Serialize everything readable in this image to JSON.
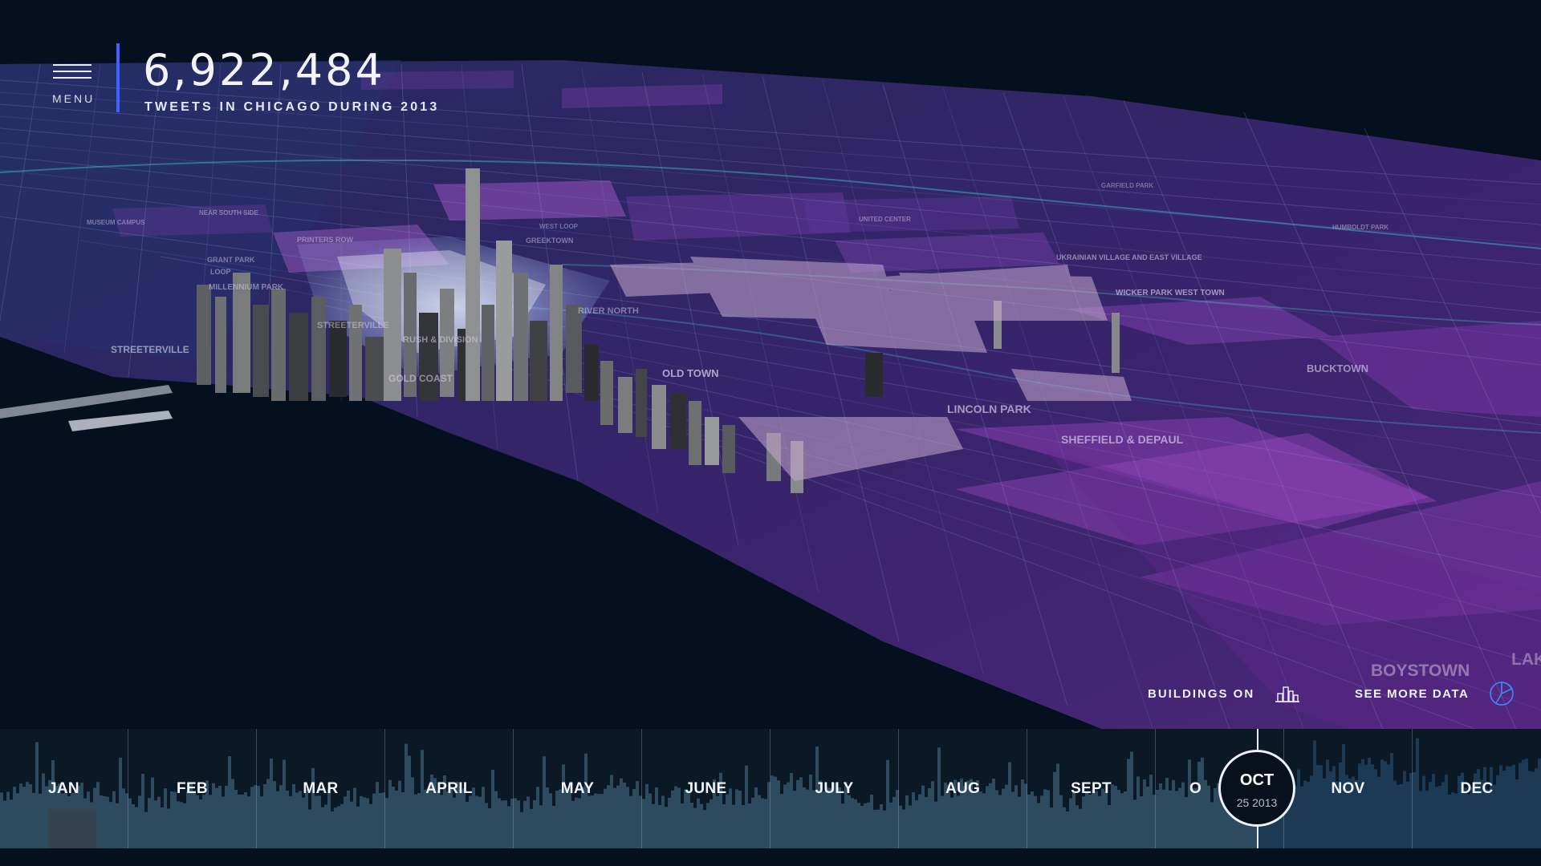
{
  "header": {
    "menu_label": "MENU",
    "tweet_count": "6,922,484",
    "caption": "TWEETS IN CHICAGO DURING 2013"
  },
  "map": {
    "labels": [
      {
        "text": "STREETERVILLE",
        "size": "big"
      },
      {
        "text": "LINCOLN PARK",
        "size": "big"
      },
      {
        "text": "SHEFFIELD & DEPAUL",
        "size": "big"
      },
      {
        "text": "BUCKTOWN",
        "size": "big"
      },
      {
        "text": "WICKER PARK WEST TOWN",
        "size": "normal"
      },
      {
        "text": "UKRAINIAN VILLAGE AND EAST VILLAGE",
        "size": "normal"
      },
      {
        "text": "OLD TOWN",
        "size": "big"
      },
      {
        "text": "GOLD COAST",
        "size": "normal"
      },
      {
        "text": "RUSH & DIVISION",
        "size": "normal"
      },
      {
        "text": "RIVER NORTH",
        "size": "normal"
      },
      {
        "text": "STREETERVILLE",
        "size": "normal"
      },
      {
        "text": "MILLENNIUM PARK",
        "size": "normal"
      },
      {
        "text": "LOOP",
        "size": "normal"
      },
      {
        "text": "GRANT PARK",
        "size": "normal"
      },
      {
        "text": "PRINTERS ROW",
        "size": "normal"
      },
      {
        "text": "GREEKTOWN",
        "size": "normal"
      },
      {
        "text": "WEST LOOP",
        "size": "normal"
      },
      {
        "text": "MUSEUM CAMPUS",
        "size": "normal"
      },
      {
        "text": "NEAR SOUTH SIDE",
        "size": "normal"
      },
      {
        "text": "HUMBOLDT PARK",
        "size": "normal"
      },
      {
        "text": "UNITED CENTER",
        "size": "normal"
      },
      {
        "text": "GARFIELD PARK",
        "size": "normal"
      },
      {
        "text": "BOYSTOWN",
        "size": "huge"
      },
      {
        "text": "LAK",
        "size": "huge"
      }
    ]
  },
  "controls": {
    "buildings_label": "BUILDINGS ON",
    "buildings_icon": "buildings-icon",
    "see_more_label": "SEE MORE DATA",
    "see_more_icon": "pie-chart-icon"
  },
  "timeline": {
    "months": [
      "JAN",
      "FEB",
      "MAR",
      "APRIL",
      "MAY",
      "JUNE",
      "JULY",
      "AUG",
      "SEPT",
      "O",
      "NOV",
      "DEC"
    ],
    "current": {
      "month": "OCT",
      "date": "25 2013"
    }
  },
  "colors": {
    "background": "#05101e",
    "accent": "#3b63ff",
    "map_purple": "#8a3fb5",
    "timeline_bar": "#2d4f66"
  }
}
